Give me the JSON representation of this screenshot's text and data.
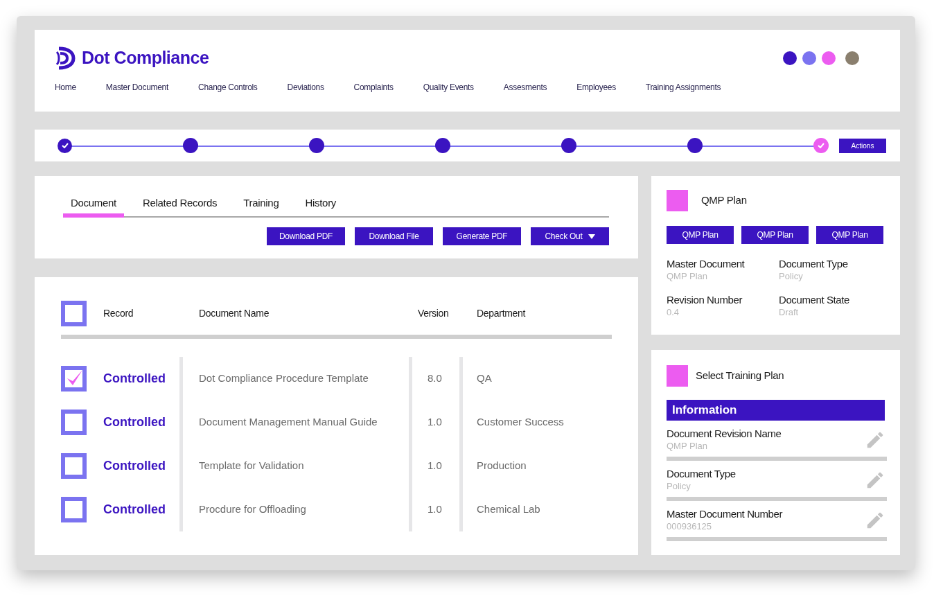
{
  "header": {
    "brand": "Dot Compliance",
    "nav": [
      "Home",
      "Master Document",
      "Change Controls",
      "Deviations",
      "Complaints",
      "Quality Events",
      "Assesments",
      "Employees",
      "Training Assignments"
    ],
    "dots": [
      {
        "color": "#3b14c1"
      },
      {
        "color": "#7b73f0"
      },
      {
        "color": "#ec5cf0"
      }
    ]
  },
  "stepper": {
    "steps": [
      {
        "kind": "done"
      },
      {
        "kind": "pending"
      },
      {
        "kind": "pending"
      },
      {
        "kind": "pending"
      },
      {
        "kind": "pending"
      },
      {
        "kind": "pending"
      },
      {
        "kind": "final"
      }
    ],
    "action": "Actions"
  },
  "tabs": [
    {
      "label": "Document",
      "selected": true
    },
    {
      "label": "Related Records",
      "selected": false
    },
    {
      "label": "Training",
      "selected": false
    },
    {
      "label": "History",
      "selected": false
    }
  ],
  "buttons": [
    {
      "label": "Download PDF",
      "kind": "plain"
    },
    {
      "label": "Download File",
      "kind": "plain"
    },
    {
      "label": "Generate PDF",
      "kind": "plain"
    },
    {
      "label": "Check Out",
      "kind": "dropdown"
    }
  ],
  "table": {
    "select_all": {
      "checked": false
    },
    "columns": [
      "Record",
      "Document Name",
      "Version",
      "Department"
    ],
    "rows": [
      {
        "checked": true,
        "record": "Controlled",
        "name": "Dot Compliance Procedure Template",
        "version": "8.0",
        "department": "QA"
      },
      {
        "checked": false,
        "record": "Controlled",
        "name": "Document Management Manual Guide",
        "version": "1.0",
        "department": "Customer Success"
      },
      {
        "checked": false,
        "record": "Controlled",
        "name": "Template for Validation",
        "version": "1.0",
        "department": "Production"
      },
      {
        "checked": false,
        "record": "Controlled",
        "name": "Procdure for Offloading",
        "version": "1.0",
        "department": "Chemical Lab"
      }
    ]
  },
  "qmp_card": {
    "title": "QMP Plan",
    "buttons": [
      "QMP Plan",
      "QMP Plan",
      "QMP Plan"
    ],
    "fields": [
      {
        "label": "Master Document",
        "value": "QMP Plan"
      },
      {
        "label": "Document Type",
        "value": "Policy"
      },
      {
        "label": "Revision Number",
        "value": "0.4"
      },
      {
        "label": "Document State",
        "value": "Draft"
      }
    ]
  },
  "training_card": {
    "title": "Select Training Plan",
    "section": "Information",
    "fields": [
      {
        "label": "Document Revision Name",
        "value": "QMP Plan"
      },
      {
        "label": "Document Type",
        "value": "Policy"
      },
      {
        "label": "Master Document Number",
        "value": "000936125"
      }
    ]
  }
}
